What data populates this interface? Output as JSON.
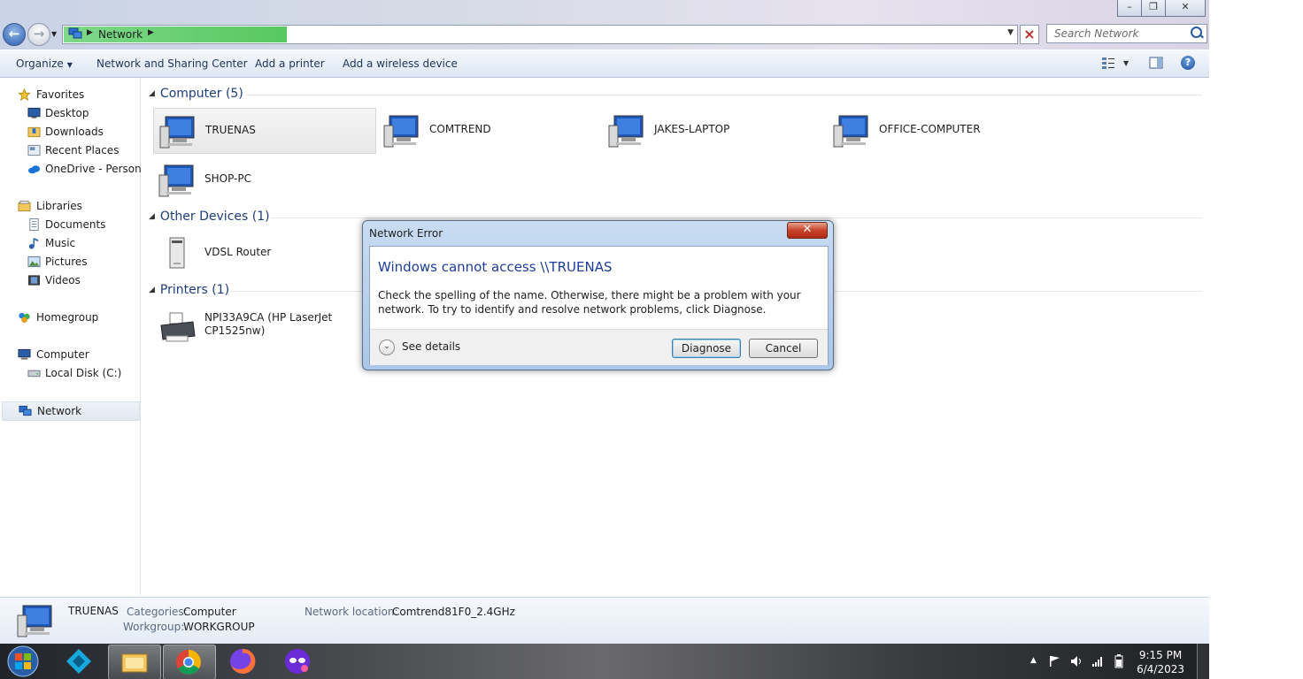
{
  "window": {
    "minimize_icon": "minimize-icon",
    "maximize_icon": "restore-icon",
    "close_icon": "close-icon"
  },
  "address_bar": {
    "location": "Network",
    "search_placeholder": "Search Network"
  },
  "toolbar": {
    "organize": "Organize",
    "sharing_center": "Network and Sharing Center",
    "add_printer": "Add a printer",
    "add_wireless": "Add a wireless device"
  },
  "sidebar": {
    "favorites": "Favorites",
    "desktop": "Desktop",
    "downloads": "Downloads",
    "recent": "Recent Places",
    "onedrive": "OneDrive - Personal",
    "libraries": "Libraries",
    "documents": "Documents",
    "music": "Music",
    "pictures": "Pictures",
    "videos": "Videos",
    "homegroup": "Homegroup",
    "computer": "Computer",
    "local_disk": "Local Disk (C:)",
    "network": "Network"
  },
  "groups": {
    "computer": "Computer (5)",
    "other": "Other Devices (1)",
    "printers": "Printers (1)"
  },
  "computers": [
    "TRUENAS",
    "COMTREND",
    "JAKES-LAPTOP",
    "OFFICE-COMPUTER",
    "SHOP-PC"
  ],
  "other_devices": [
    "VDSL Router"
  ],
  "printer": {
    "line1": "NPI33A9CA (HP LaserJet",
    "line2": "CP1525nw)"
  },
  "details": {
    "name": "TRUENAS",
    "categories_label": "Categories:",
    "categories_value": "Computer",
    "workgroup_label": "Workgroup:",
    "workgroup_value": "WORKGROUP",
    "location_label": "Network location:",
    "location_value": "Comtrend81F0_2.4GHz"
  },
  "dialog": {
    "title": "Network Error",
    "heading": "Windows cannot access \\\\TRUENAS",
    "message": "Check the spelling of the name. Otherwise, there might be a problem with your network. To try to identify and resolve network problems, click Diagnose.",
    "see_details": "See details",
    "diagnose": "Diagnose",
    "cancel": "Cancel"
  },
  "taskbar": {
    "time": "9:15 PM",
    "date": "6/4/2023"
  },
  "colors": {
    "group_heading": "#1e3d7a",
    "dialog_heading": "#1e3d9a",
    "address_highlight": "#57c85f"
  }
}
